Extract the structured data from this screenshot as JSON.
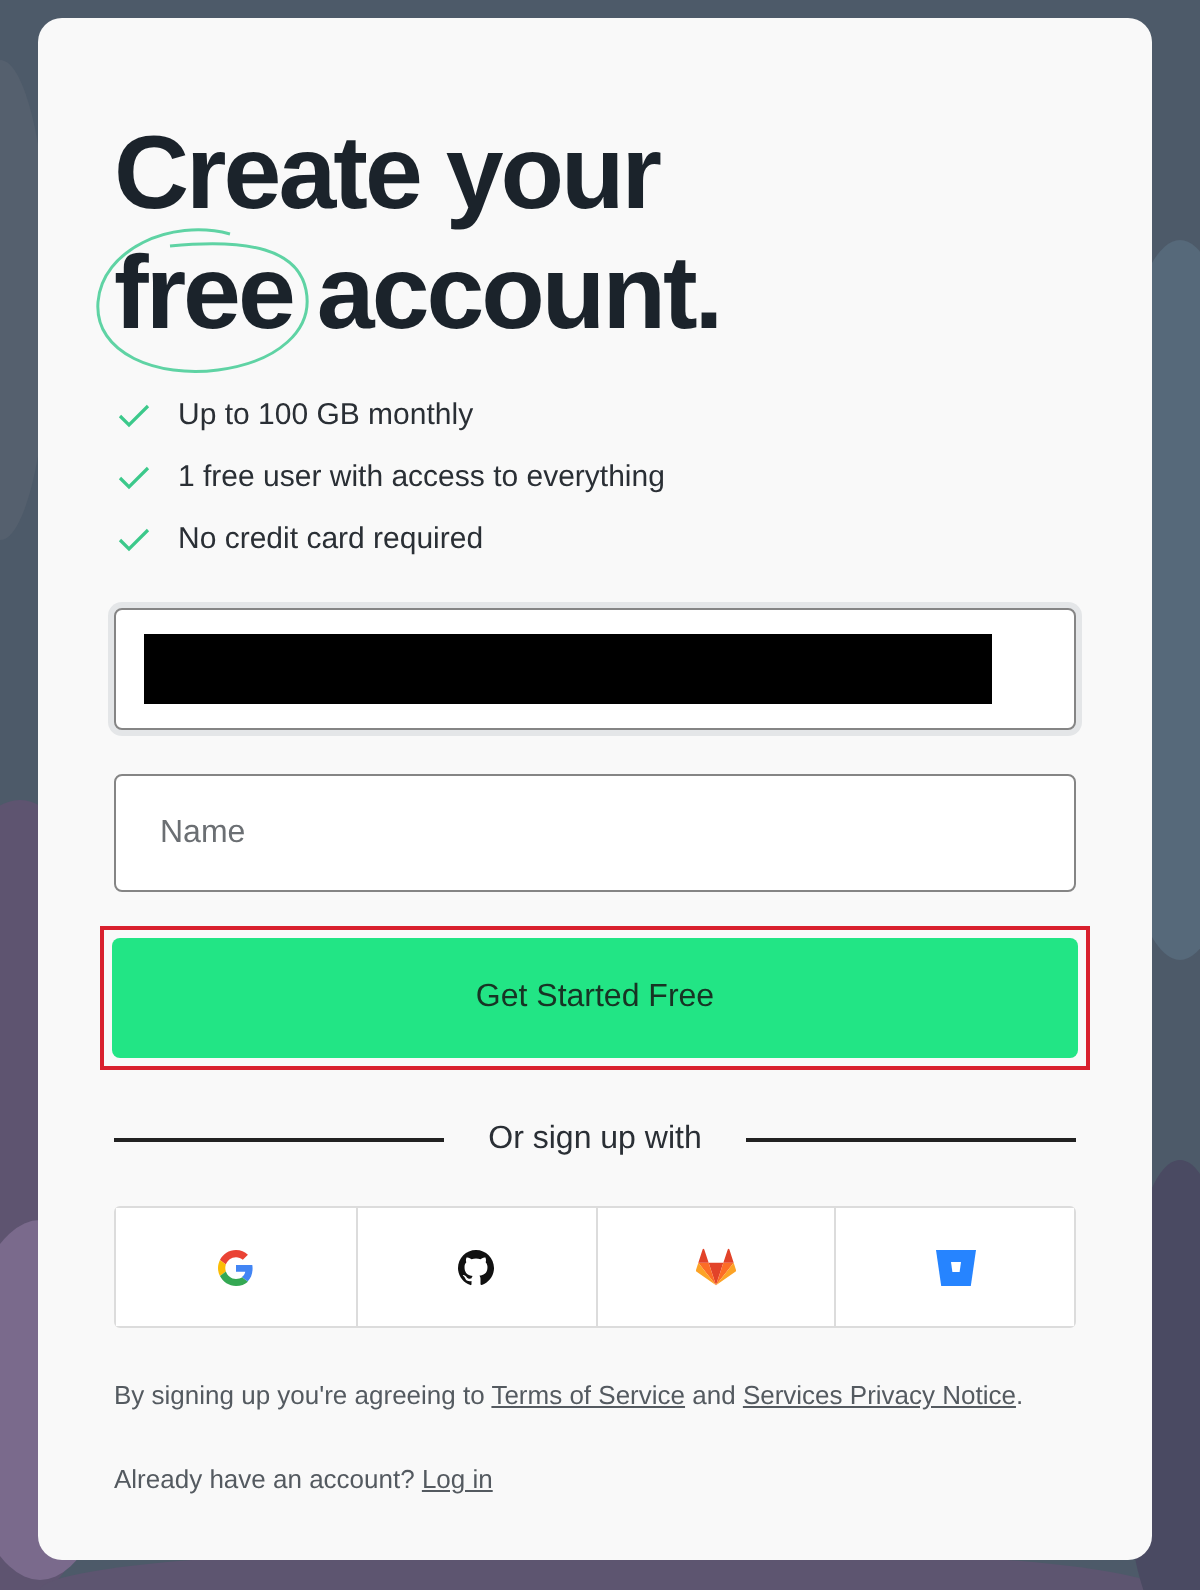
{
  "heading": {
    "line_1": "Create your",
    "circled_word": "free",
    "rest": "account."
  },
  "benefits": [
    "Up to 100 GB monthly",
    "1 free user with access to everything",
    "No credit card required"
  ],
  "email_field": {
    "redacted": true
  },
  "name_field": {
    "placeholder": "Name"
  },
  "submit_button": {
    "label": "Get Started Free",
    "highlighted": true
  },
  "divider_label": "Or sign up with",
  "providers": [
    {
      "kind": "google"
    },
    {
      "kind": "github"
    },
    {
      "kind": "gitlab"
    },
    {
      "kind": "bitbucket"
    }
  ],
  "terms": [
    {
      "kind": "text",
      "text": "By signing up you're agreeing to "
    },
    {
      "kind": "link",
      "text": "Terms of Service"
    },
    {
      "kind": "text",
      "text": " and "
    },
    {
      "kind": "link",
      "text": "Services Privacy Notice"
    },
    {
      "kind": "text",
      "text": "."
    }
  ],
  "login": [
    {
      "kind": "text",
      "text": "Already have an account? "
    },
    {
      "kind": "link",
      "text": "Log in"
    }
  ]
}
